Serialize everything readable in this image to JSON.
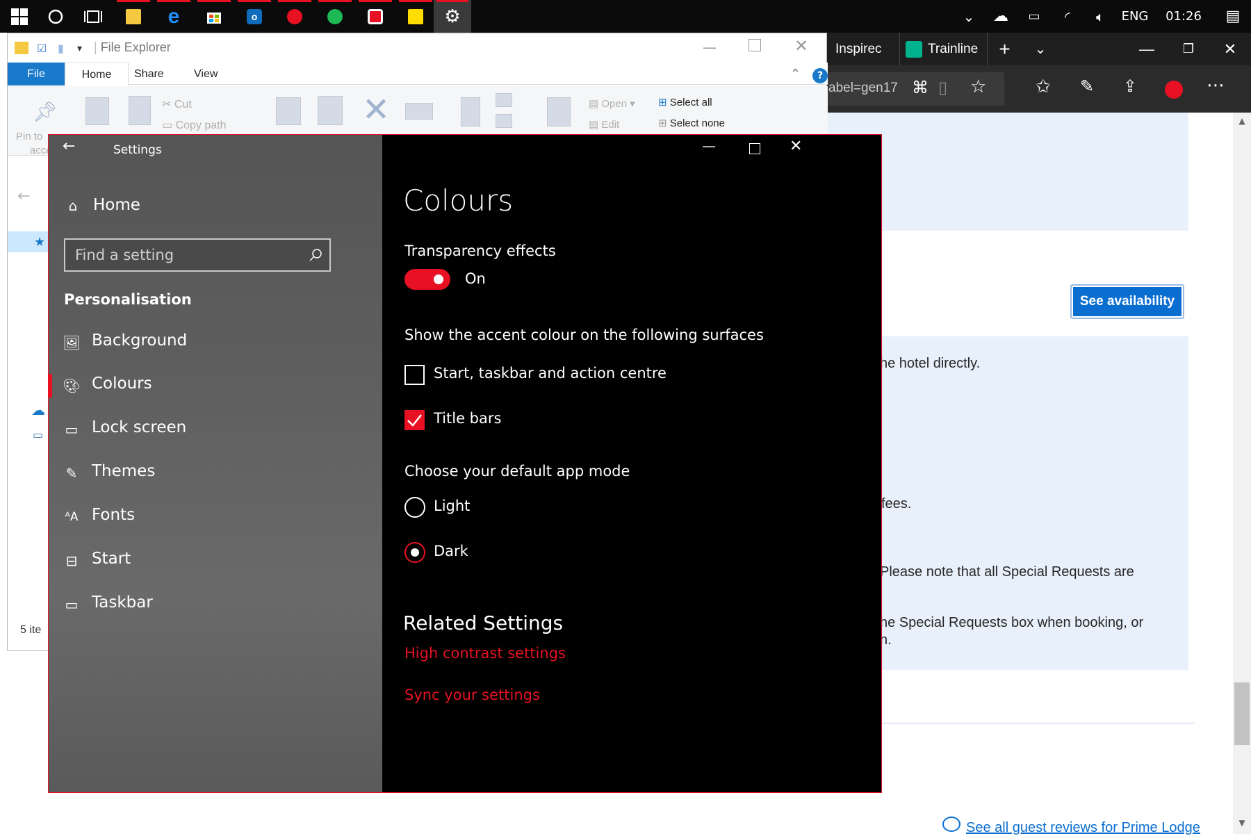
{
  "taskbar": {
    "tray": {
      "language": "ENG",
      "time": "01:26"
    }
  },
  "browser": {
    "tabs": [
      {
        "label": "Inspirec"
      },
      {
        "label": "Trainline"
      }
    ],
    "address_fragment": "abel=gen17",
    "see_availability": "See availability",
    "texts": [
      "he hotel directly.",
      "fees.",
      "Please note that all Special Requests are",
      "he Special Requests box when booking, or",
      "n."
    ],
    "reviews_link": "See all guest reviews for Prime Lodge"
  },
  "explorer": {
    "title": "File Explorer",
    "tabs": {
      "file": "File",
      "home": "Home",
      "share": "Share",
      "view": "View"
    },
    "ribbon": {
      "cut": "Cut",
      "copy_path": "Copy path",
      "open": "Open",
      "edit": "Edit",
      "select_all": "Select all",
      "select_none": "Select none",
      "pin_to": "Pin to",
      "pin_to_2": "acce"
    },
    "status": "5 ite"
  },
  "settings": {
    "title": "Settings",
    "home": "Home",
    "search_placeholder": "Find a setting",
    "section": "Personalisation",
    "nav_items": [
      {
        "label": "Background",
        "icon": "image-icon"
      },
      {
        "label": "Colours",
        "icon": "palette-icon"
      },
      {
        "label": "Lock screen",
        "icon": "lock-screen-icon"
      },
      {
        "label": "Themes",
        "icon": "brush-icon"
      },
      {
        "label": "Fonts",
        "icon": "font-icon"
      },
      {
        "label": "Start",
        "icon": "start-icon"
      },
      {
        "label": "Taskbar",
        "icon": "taskbar-icon"
      }
    ],
    "selected": "Colours",
    "page_title": "Colours",
    "transparency_label": "Transparency effects",
    "transparency_state": "On",
    "accent_heading": "Show the accent colour on the following surfaces",
    "accent_options": [
      {
        "label": "Start, taskbar and action centre",
        "checked": false
      },
      {
        "label": "Title bars",
        "checked": true
      }
    ],
    "app_mode_heading": "Choose your default app mode",
    "app_modes": [
      {
        "label": "Light",
        "selected": false
      },
      {
        "label": "Dark",
        "selected": true
      }
    ],
    "related_heading": "Related Settings",
    "related_links": [
      "High contrast settings",
      "Sync your settings"
    ],
    "accent_color": "#e81123"
  }
}
